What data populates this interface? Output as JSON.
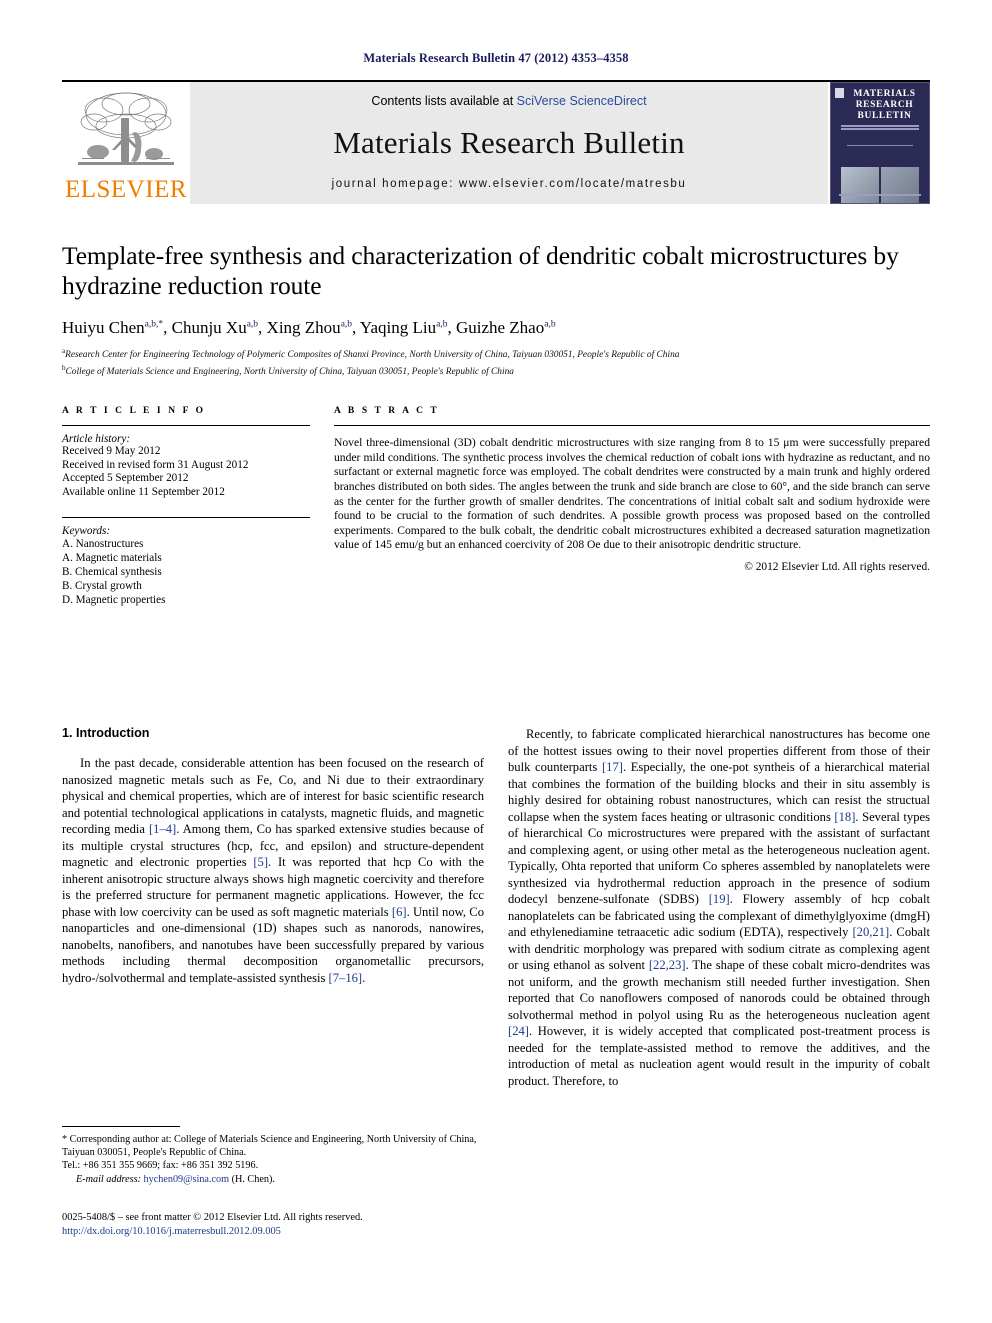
{
  "running_head": "Materials Research Bulletin 47 (2012) 4353–4358",
  "masthead": {
    "publisher_name": "ELSEVIER",
    "contents_prefix": "Contents lists available at ",
    "contents_link": "SciVerse ScienceDirect",
    "journal_name": "Materials Research Bulletin",
    "homepage": "journal homepage: www.elsevier.com/locate/matresbu",
    "cover_title": "MATERIALS RESEARCH BULLETIN"
  },
  "article": {
    "title": "Template-free synthesis and characterization of dendritic cobalt microstructures by hydrazine reduction route",
    "authors": [
      {
        "name": "Huiyu Chen",
        "sup": "a,b,*"
      },
      {
        "name": "Chunju Xu",
        "sup": "a,b"
      },
      {
        "name": "Xing Zhou",
        "sup": "a,b"
      },
      {
        "name": "Yaqing Liu",
        "sup": "a,b"
      },
      {
        "name": "Guizhe Zhao",
        "sup": "a,b"
      }
    ],
    "affiliations": [
      {
        "mark": "a",
        "text": "Research Center for Engineering Technology of Polymeric Composites of Shanxi Province, North University of China, Taiyuan 030051, People's Republic of China"
      },
      {
        "mark": "b",
        "text": "College of Materials Science and Engineering, North University of China, Taiyuan 030051, People's Republic of China"
      }
    ]
  },
  "info": {
    "heading": "A R T I C L E   I N F O",
    "history_label": "Article history:",
    "history": [
      "Received 9 May 2012",
      "Received in revised form 31 August 2012",
      "Accepted 5 September 2012",
      "Available online 11 September 2012"
    ],
    "keywords_label": "Keywords:",
    "keywords": [
      "A. Nanostructures",
      "A. Magnetic materials",
      "B. Chemical synthesis",
      "B. Crystal growth",
      "D. Magnetic properties"
    ]
  },
  "abstract": {
    "heading": "A B S T R A C T",
    "text": "Novel three-dimensional (3D) cobalt dendritic microstructures with size ranging from 8 to 15 μm were successfully prepared under mild conditions. The synthetic process involves the chemical reduction of cobalt ions with hydrazine as reductant, and no surfactant or external magnetic force was employed. The cobalt dendrites were constructed by a main trunk and highly ordered branches distributed on both sides. The angles between the trunk and side branch are close to 60°, and the side branch can serve as the center for the further growth of smaller dendrites. The concentrations of initial cobalt salt and sodium hydroxide were found to be crucial to the formation of such dendrites. A possible growth process was proposed based on the controlled experiments. Compared to the bulk cobalt, the dendritic cobalt microstructures exhibited a decreased saturation magnetization value of 145 emu/g but an enhanced coercivity of 208 Oe due to their anisotropic dendritic structure.",
    "copyright": "© 2012 Elsevier Ltd. All rights reserved."
  },
  "introduction": {
    "section_title": "1. Introduction",
    "left_paragraph_1_a": "In the past decade, considerable attention has been focused on the research of nanosized magnetic metals such as Fe, Co, and Ni due to their extraordinary physical and chemical properties, which are of interest for basic scientific research and potential technological applications in catalysts, magnetic fluids, and magnetic recording media ",
    "ref_1_4": "[1–4]",
    "left_paragraph_1_b": ". Among them, Co has sparked extensive studies because of its multiple crystal structures (hcp, fcc, and epsilon) and structure-dependent magnetic and electronic properties ",
    "ref_5": "[5]",
    "left_paragraph_1_c": ". It was reported that hcp Co with the inherent anisotropic structure always shows high magnetic coercivity and therefore is the preferred structure for permanent magnetic applications. However, the fcc phase with low coercivity can be used as soft magnetic materials ",
    "ref_6": "[6]",
    "left_paragraph_1_d": ". Until now, Co nanoparticles and one-dimensional (1D) shapes such as nanorods, nanowires, nanobelts, nanofibers, and nanotubes have been successfully prepared by various methods including thermal decomposition organometallic precursors, hydro-/solvothermal and template-assisted synthesis ",
    "ref_7_16": "[7–16]",
    "left_paragraph_1_e": ".",
    "right_paragraph_a": "Recently, to fabricate complicated hierarchical nanostructures has become one of the hottest issues owing to their novel properties different from those of their bulk counterparts ",
    "ref_17": "[17]",
    "right_paragraph_b": ". Especially, the one-pot syntheis of a hierarchical material that combines the formation of the building blocks and their in situ assembly is highly desired for obtaining robust nanostructures, which can resist the structual collapse when the system faces heating or ultrasonic conditions ",
    "ref_18": "[18]",
    "right_paragraph_c": ". Several types of hierarchical Co microstructures were prepared with the assistant of surfactant and complexing agent, or using other metal as the heterogeneous nucleation agent. Typically, Ohta reported that uniform Co spheres assembled by nanoplatelets were synthesized via hydrothermal reduction approach in the presence of sodium dodecyl benzene-sulfonate (SDBS) ",
    "ref_19": "[19]",
    "right_paragraph_d": ". Flowery assembly of hcp cobalt nanoplatelets can be fabricated using the complexant of dimethylglyoxime (dmgH) and ethylenediamine tetraacetic adic sodium (EDTA), respectively ",
    "ref_20_21": "[20,21]",
    "right_paragraph_e": ". Cobalt with dendritic morphology was prepared with sodium citrate as complexing agent or using ethanol as solvent ",
    "ref_22_23": "[22,23]",
    "right_paragraph_f": ". The shape of these cobalt micro-dendrites was not uniform, and the growth mechanism still needed further investigation. Shen reported that Co nanoflowers composed of nanorods could be obtained through solvothermal method in polyol using Ru as the heterogeneous nucleation agent ",
    "ref_24": "[24]",
    "right_paragraph_g": ". However, it is widely accepted that complicated post-treatment process is needed for the template-assisted method to remove the additives, and the introduction of metal as nucleation agent would result in the impurity of cobalt product. Therefore, to"
  },
  "footnote": {
    "star": "*",
    "corresponding": " Corresponding author at: College of Materials Science and Engineering, North University of China, Taiyuan 030051, People's Republic of China.",
    "tel": "Tel.: +86 351 355 9669; fax: +86 351 392 5196.",
    "email_label": "E-mail address:",
    "email": "hychen09@sina.com",
    "email_suffix": " (H. Chen)."
  },
  "page_footer": {
    "issn_line": "0025-5408/$ – see front matter © 2012 Elsevier Ltd. All rights reserved.",
    "doi": "http://dx.doi.org/10.1016/j.materresbull.2012.09.005"
  },
  "colors": {
    "link_blue": "#2b4a9b",
    "ref_blue": "#1b3a8c",
    "running_head_navy": "#1b1b5e",
    "elsevier_orange": "#f07c00",
    "band_gray": "#e9e9e9",
    "cover_navy": "#2a2a55"
  }
}
